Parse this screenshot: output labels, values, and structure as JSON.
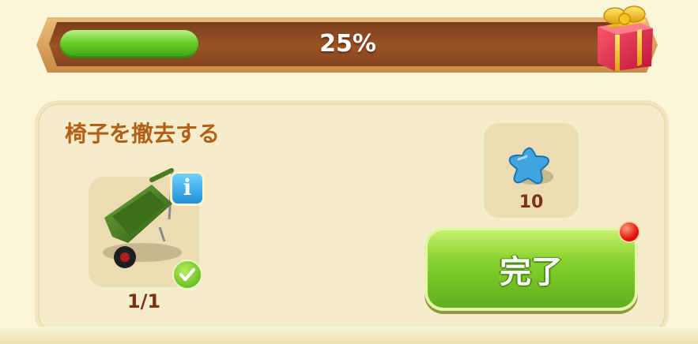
{
  "progress": {
    "percent": 25,
    "label": "25%"
  },
  "task": {
    "title": "椅子を撤去する",
    "item": {
      "icon": "wheelbarrow-icon",
      "count_label": "1/1",
      "info_label": "i",
      "completed": true
    },
    "reward": {
      "icon": "blue-star-icon",
      "amount": "10"
    },
    "complete_button": {
      "label": "完了",
      "has_notification": true
    }
  },
  "colors": {
    "accent_green": "#67cf24",
    "title_brown": "#b35f16",
    "count_brown": "#7a3312",
    "notification_red": "#e0160c",
    "background": "#fbf6d9"
  }
}
